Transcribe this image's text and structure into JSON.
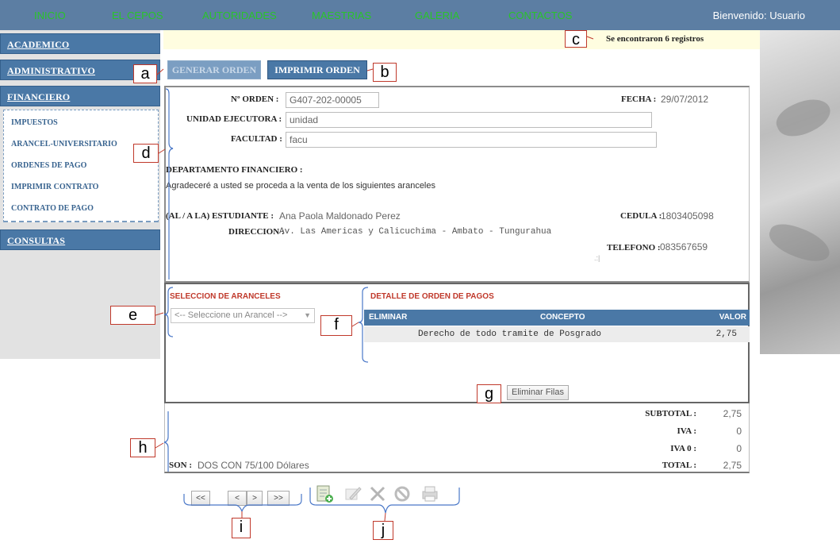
{
  "nav": {
    "items": [
      "INICIO",
      "EL CEPOS",
      "AUTORIDADES",
      "MAESTRIAS",
      "GALERIA",
      "CONTACTOS"
    ],
    "welcome": "Bienvenido: Usuario"
  },
  "sidebar": {
    "academico": "ACADEMICO",
    "administrativo": "ADMINISTRATIVO",
    "financiero": "FINANCIERO",
    "consultas": "CONSULTAS",
    "submenu": [
      "IMPUESTOS",
      "ARANCEL-UNIVERSITARIO",
      "ORDENES DE PAGO",
      "IMPRIMIR CONTRATO",
      "CONTRATO DE PAGO"
    ]
  },
  "notice": "Se encontraron 6 registros",
  "buttons": {
    "generar": "GENERAR ORDEN",
    "imprimir": "IMPRIMIR ORDEN",
    "eliminar": "Eliminar Filas"
  },
  "form": {
    "orden_label": "Nº ORDEN :",
    "orden_value": "G407-202-00005",
    "fecha_label": "FECHA :",
    "fecha_value": "29/07/2012",
    "unidad_label": "UNIDAD EJECUTORA :",
    "unidad_value": "unidad",
    "facultad_label": "FACULTAD :",
    "facultad_value": "facu",
    "departamento_label": "DEPARTAMENTO FINANCIERO :",
    "departamento_text": "Agradeceré a usted se proceda a la venta de los siguientes aranceles",
    "estudiante_label": "(AL / A LA) ESTUDIANTE :",
    "estudiante_value": "Ana Paola Maldonado Perez",
    "cedula_label": "CEDULA :",
    "cedula_value": "1803405098",
    "direccion_label": "DIRECCION :",
    "direccion_value": "Av. Las Americas y Calicuchima - Ambato - Tungurahua",
    "telefono_label": "TELEFONO :",
    "telefono_value": "083567659"
  },
  "aranceles": {
    "title": "SELECCION DE ARANCELES",
    "select_placeholder": "<-- Seleccione un Arancel -->"
  },
  "detalle": {
    "title": "DETALLE DE ORDEN DE PAGOS",
    "columns": [
      "ELIMINAR",
      "CONCEPTO",
      "VALOR"
    ],
    "rows": [
      {
        "concepto": "Derecho de todo tramite de Posgrado",
        "valor": "2,75"
      }
    ]
  },
  "totals": {
    "subtotal_label": "SUBTOTAL :",
    "subtotal_value": "2,75",
    "iva_label": "IVA :",
    "iva_value": "0",
    "iva0_label": "IVA 0 :",
    "iva0_value": "0",
    "total_label": "TOTAL :",
    "total_value": "2,75",
    "son_label": "SON :",
    "son_value": "DOS CON 75/100 Dólares"
  },
  "pager": [
    "<<",
    "<",
    ">",
    ">>"
  ],
  "toolbar_icons": [
    "new-record-icon",
    "edit-icon",
    "delete-icon",
    "cancel-icon",
    "print-icon"
  ],
  "callouts": [
    "a",
    "b",
    "c",
    "d",
    "e",
    "f",
    "g",
    "h",
    "i",
    "j"
  ],
  "colors": {
    "nav_bg": "#5c7ea3",
    "nav_link": "#29c429",
    "accent": "#4a78a6",
    "section_title": "#c0392b",
    "callout_border": "#c0392b"
  }
}
